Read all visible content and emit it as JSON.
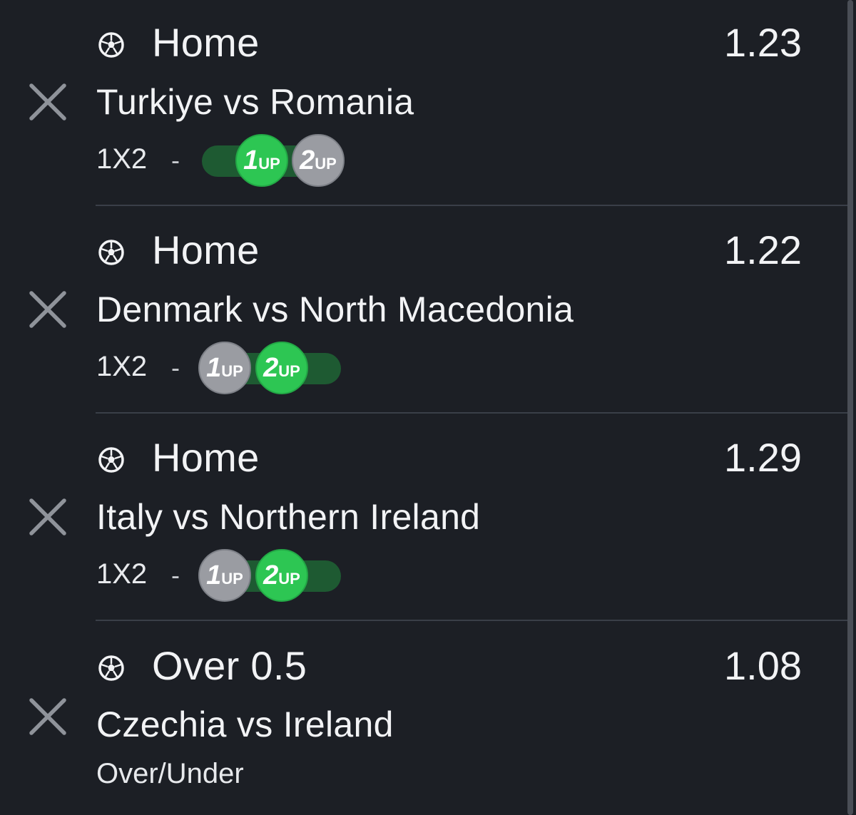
{
  "bets": [
    {
      "selection": "Home",
      "odds": "1.23",
      "match": "Turkiye vs Romania",
      "market": "1X2",
      "separator": "-",
      "boost": {
        "first_num": "1",
        "first_suffix": "UP",
        "second_num": "2",
        "second_suffix": "UP",
        "active": "1UP"
      }
    },
    {
      "selection": "Home",
      "odds": "1.22",
      "match": "Denmark vs North Macedonia",
      "market": "1X2",
      "separator": "-",
      "boost": {
        "first_num": "1",
        "first_suffix": "UP",
        "second_num": "2",
        "second_suffix": "UP",
        "active": "2UP"
      }
    },
    {
      "selection": "Home",
      "odds": "1.29",
      "match": "Italy vs Northern Ireland",
      "market": "1X2",
      "separator": "-",
      "boost": {
        "first_num": "1",
        "first_suffix": "UP",
        "second_num": "2",
        "second_suffix": "UP",
        "active": "2UP"
      }
    },
    {
      "selection": "Over 0.5",
      "odds": "1.08",
      "match": "Czechia vs Ireland",
      "market": "Over/Under"
    }
  ],
  "icons": {
    "remove": "close-icon",
    "sport": "soccer-ball-icon"
  },
  "colors": {
    "background": "#1c1f25",
    "active_green": "#2dc653",
    "track_green": "#1e5a32",
    "inactive_grey": "#9a9ca2",
    "divider": "#3a3f48"
  }
}
